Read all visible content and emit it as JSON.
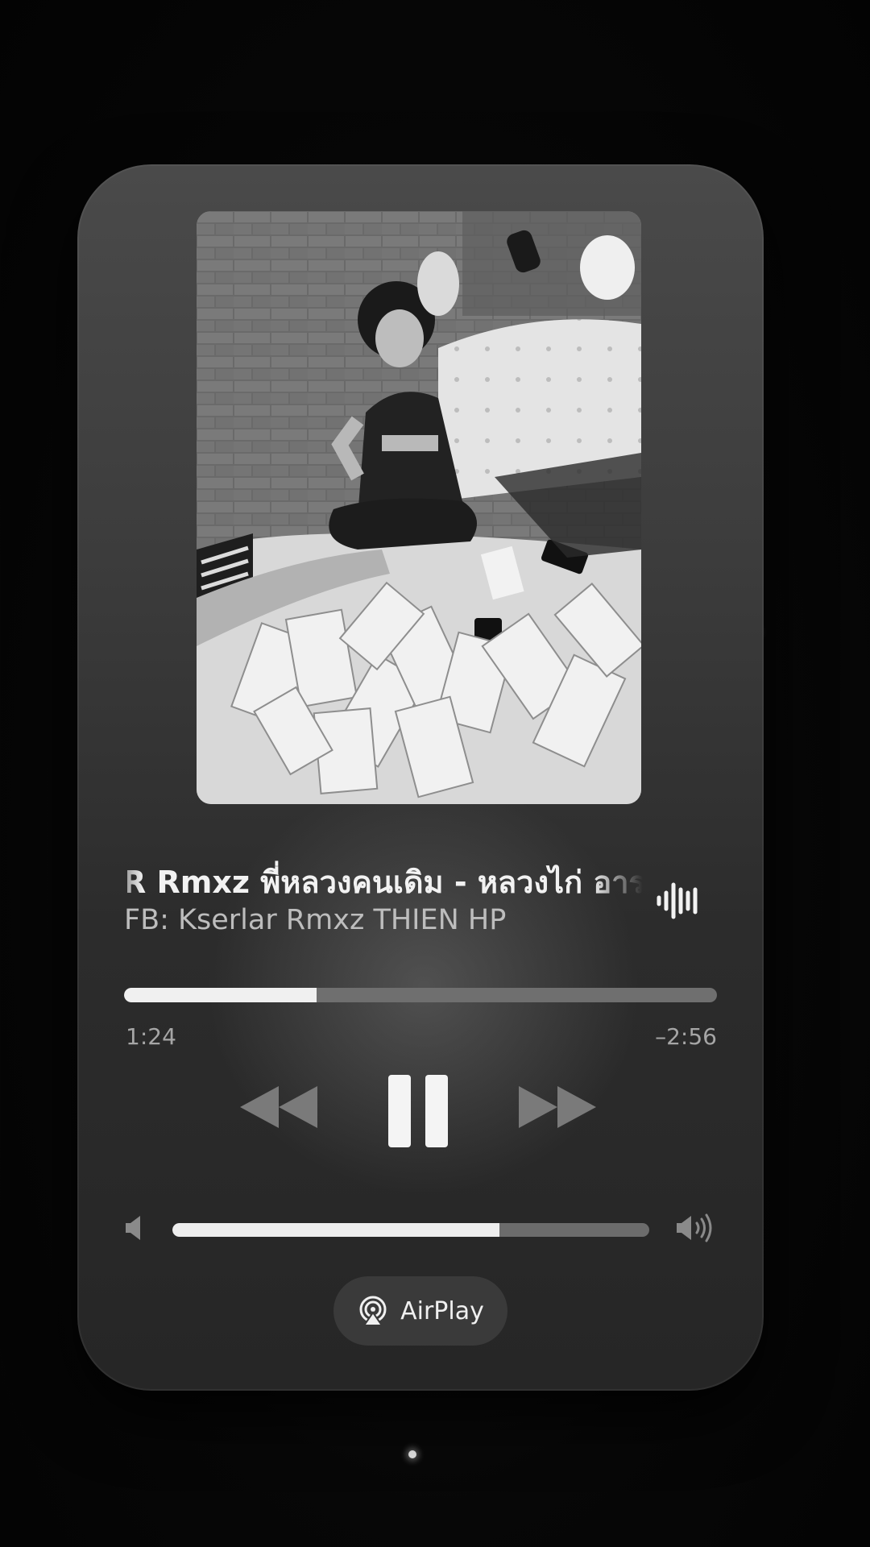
{
  "player": {
    "title": "R Rmxz พี่หลวงคนเดิม - หลวงไก่ อาร",
    "artist": "FB: Kserlar Rmxz THIEN HP",
    "elapsed": "1:24",
    "remaining": "–2:56",
    "progress_fraction": 0.325,
    "volume_fraction": 0.685,
    "is_playing": true
  },
  "airplay": {
    "label": "AirPlay"
  },
  "icons": {
    "waveform": "waveform-icon",
    "rewind": "rewind-icon",
    "pause": "pause-icon",
    "forward": "fast-forward-icon",
    "volume_low": "speaker-low-icon",
    "volume_high": "speaker-high-icon",
    "airplay": "airplay-icon"
  },
  "colors": {
    "card_top": "#4a4a4a",
    "card_bottom": "#262626",
    "fill": "#f0f0f0",
    "track": "#6f6f6f",
    "secondary_text": "#a6a6a6"
  }
}
